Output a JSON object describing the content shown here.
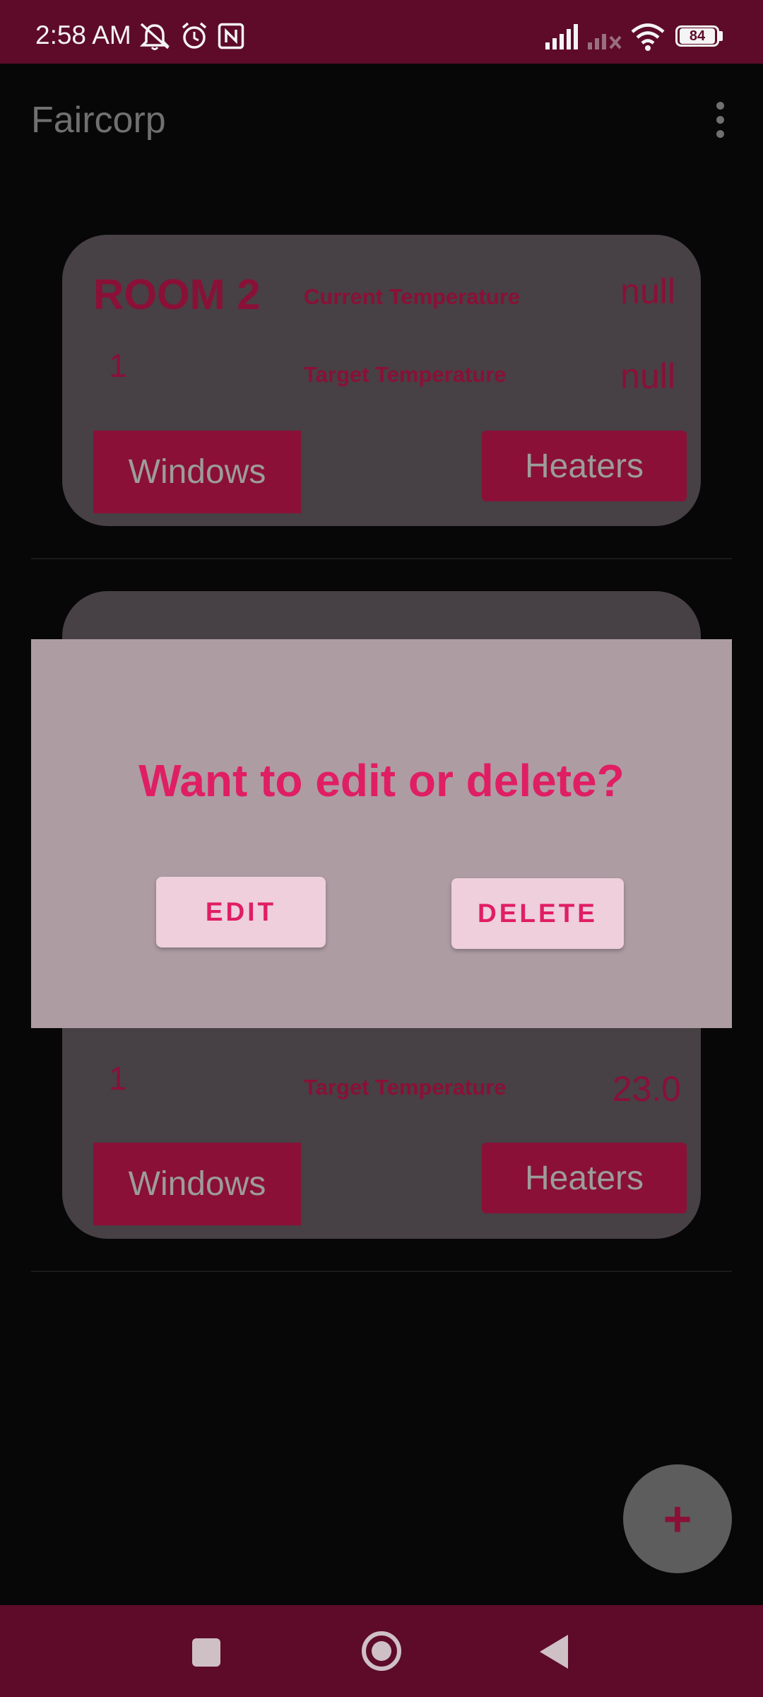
{
  "status_bar": {
    "time": "2:58 AM",
    "battery": "84",
    "icons": [
      "mute-alerts-icon",
      "alarm-icon",
      "nfc-icon",
      "signal-icon",
      "signal-no-service-icon",
      "wifi-icon",
      "battery-icon"
    ]
  },
  "app_bar": {
    "title": "Faircorp",
    "menu_icon": "more-vert-icon"
  },
  "rooms": [
    {
      "name": "ROOM 2",
      "floor": "1",
      "current_temperature_label": "Current Temperature",
      "current_temperature_value": "null",
      "target_temperature_label": "Target Temperature",
      "target_temperature_value": "null",
      "windows_button": "Windows",
      "heaters_button": "Heaters"
    },
    {
      "floor": "1",
      "target_temperature_label": "Target Temperature",
      "target_temperature_value": "23.0",
      "windows_button": "Windows",
      "heaters_button": "Heaters"
    }
  ],
  "dialog": {
    "title": "Want to edit or delete?",
    "edit_button": "EDIT",
    "delete_button": "DELETE"
  },
  "fab": {
    "label": "+",
    "icon": "add-icon"
  },
  "nav_bar": {
    "icons": [
      "recents-icon",
      "home-icon",
      "back-icon"
    ]
  },
  "colors": {
    "status_bar": "#5d0b29",
    "accent": "#e01e63",
    "card": "#474044",
    "dialog": "#ae9ca3"
  }
}
